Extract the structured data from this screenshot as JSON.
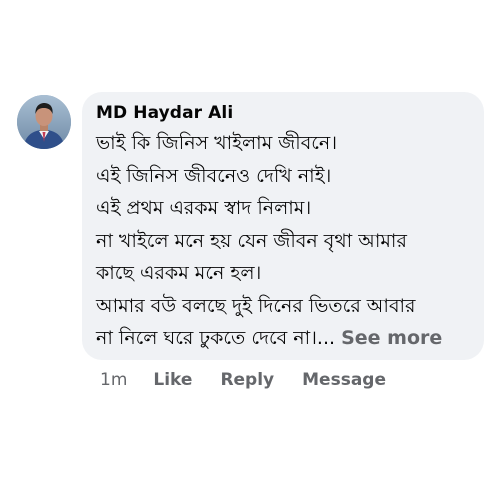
{
  "comment": {
    "author": "MD Haydar Ali",
    "lines": [
      "ভাই কি জিনিস খাইলাম জীবনে।",
      "এই জিনিস জীবনেও দেখি নাই।",
      "এই প্রথম এরকম স্বাদ নিলাম।",
      "না খাইলে মনে হয় যেন জীবন বৃথা আমার",
      "কাছে এরকম মনে হল।",
      "আমার বউ বলছে দুই দিনের ভিতরে আবার",
      "না নিলে ঘরে ঢুকতে দেবে না।..."
    ],
    "see_more_label": "See more"
  },
  "actions": {
    "timestamp": "1m",
    "like_label": "Like",
    "reply_label": "Reply",
    "message_label": "Message"
  },
  "icons": {
    "avatar": "profile-photo"
  },
  "colors": {
    "bubble_background": "#f0f2f5",
    "primary_text": "#050505",
    "secondary_text": "#65676b"
  }
}
